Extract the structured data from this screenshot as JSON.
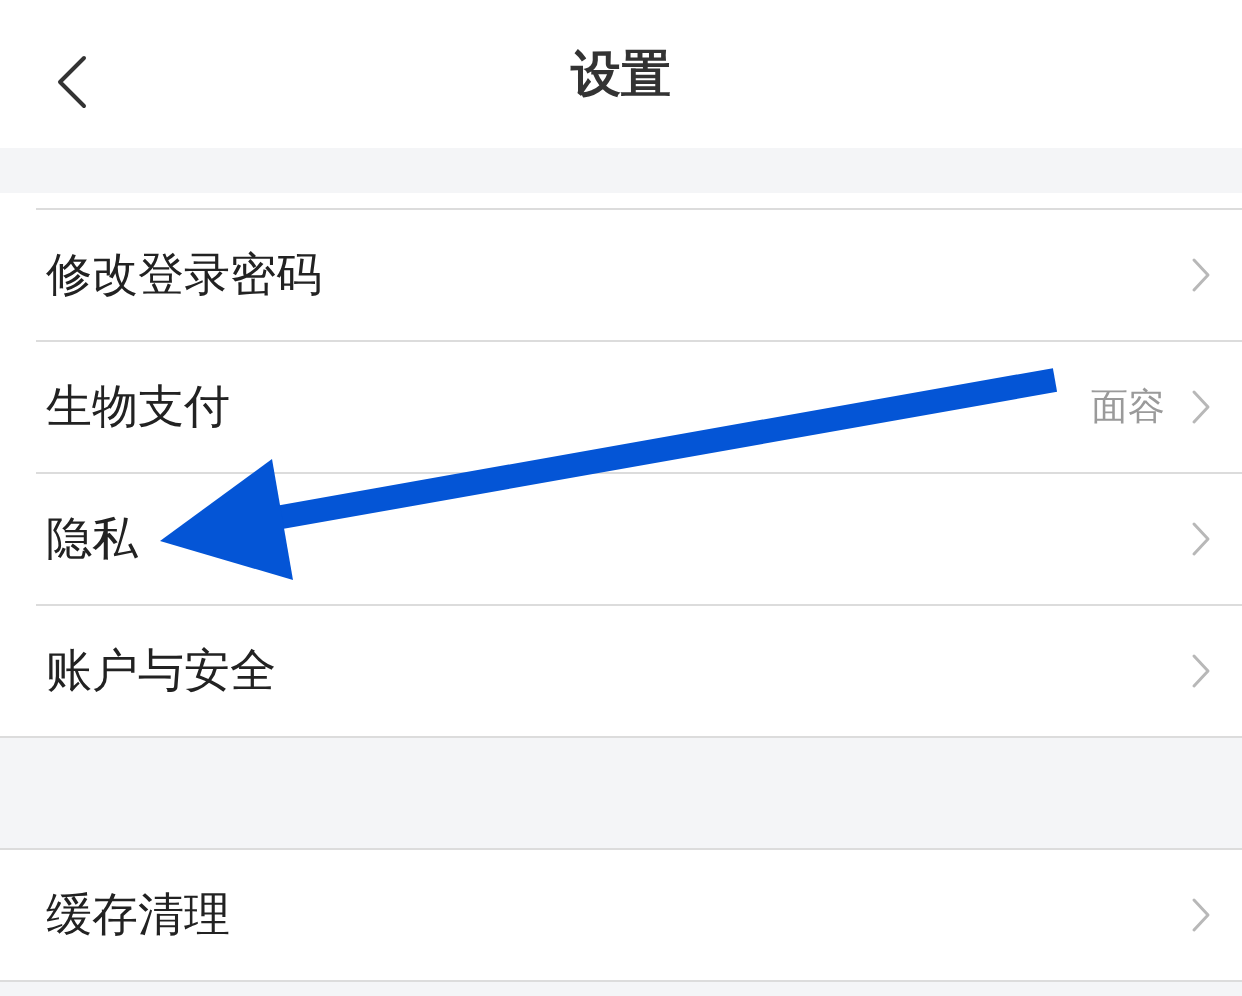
{
  "header": {
    "title": "设置"
  },
  "groups": [
    {
      "items": [
        {
          "label": "修改登录密码"
        },
        {
          "label": "生物支付",
          "value": "面容"
        },
        {
          "label": "隐私"
        },
        {
          "label": "账户与安全"
        }
      ]
    },
    {
      "items": [
        {
          "label": "缓存清理"
        }
      ]
    }
  ],
  "annotation": {
    "kind": "arrow"
  }
}
